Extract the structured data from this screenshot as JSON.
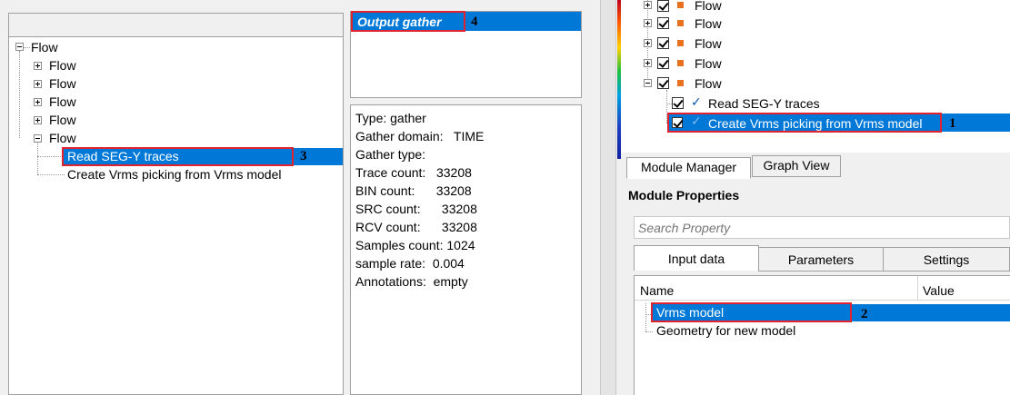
{
  "left_tree": {
    "root_label": "Flow",
    "flow_items": [
      "Flow",
      "Flow",
      "Flow",
      "Flow",
      "Flow"
    ],
    "module_items": [
      "Read SEG-Y traces",
      "Create Vrms picking from Vrms model"
    ],
    "marker": "3"
  },
  "output_panel": {
    "title": "Output gather",
    "marker": "4"
  },
  "info_panel": {
    "lines": [
      "Type: gather",
      "Gather domain:   TIME",
      "Gather type:",
      "Trace count:   33208",
      "BIN count:      33208",
      "SRC count:      33208",
      "RCV count:      33208",
      "Samples count: 1024",
      "sample rate:  0.004",
      "Annotations:  empty"
    ]
  },
  "right_tree": {
    "flow_items": [
      "Flow",
      "Flow",
      "Flow",
      "Flow",
      "Flow"
    ],
    "module_items": [
      "Read SEG-Y traces",
      "Create Vrms picking from Vrms model"
    ],
    "marker": "1"
  },
  "bottom_tabs": [
    "Module Manager",
    "Graph View"
  ],
  "module_properties": {
    "title": "Module Properties",
    "search_placeholder": "Search Property",
    "tabs": [
      "Input data",
      "Parameters",
      "Settings"
    ],
    "columns": [
      "Name",
      "Value"
    ],
    "rows": [
      "Vrms model",
      "Geometry for new model"
    ],
    "marker": "2"
  },
  "colors": {
    "selection": "#0078d7",
    "highlight_box": "#e0232e",
    "flow_icon": "#e8711f"
  }
}
